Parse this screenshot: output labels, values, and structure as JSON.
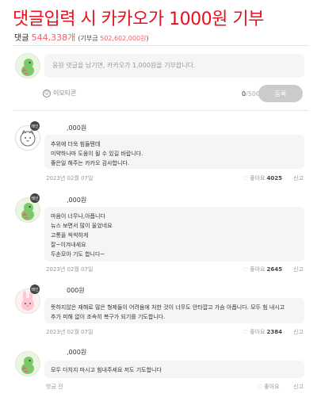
{
  "banner": "댓글입력 시 카카오가 1000원 기부",
  "summary": {
    "label": "댓글",
    "count": "544,338개",
    "donation_prefix": "(기부금 ",
    "donation_amount": "502,602,000원",
    "donation_suffix": ")"
  },
  "input": {
    "placeholder": "응원 댓글을 남기면, 카카오가 1,000원을 기부합니다.",
    "emoticon_label": "이모티콘",
    "count_current": "0",
    "count_max": "/500",
    "submit_label": "등록"
  },
  "comments": [
    {
      "name": ",000원",
      "badge": "메인",
      "lines": [
        "추위에 더욱 힘들텐데",
        "미약하나마 도움이 될 수 있길 바랍니다.",
        "좋은일 해주는 카카오 감사합니다."
      ],
      "date": "2023년 02월 07일",
      "like_label": "좋아요",
      "likes": "4025",
      "report": "신고"
    },
    {
      "name": ",000원",
      "badge": "메인",
      "lines": [
        "마음이 너무나,아픕니다",
        "뉴스 보면서 많이 울었네요",
        "고통을 씩씩하게",
        "잘~이겨내세요",
        "두손모아 기도 합니다~"
      ],
      "date": "2023년 02월 07일",
      "like_label": "좋아요",
      "likes": "2645",
      "report": "신고"
    },
    {
      "name": "000원",
      "badge": "메인",
      "lines": [
        "뜻하지않은 재해로 많은 형제들이 어려움에 처한 것이 너무도 안타깝고 가슴 아픕니다. 모두 힘 내시고",
        "추가 피해 없이 조속히 복구가 되기를 기도합니다."
      ],
      "date": "2023년 02월 07일",
      "like_label": "좋아요",
      "likes": "2384",
      "report": "신고"
    },
    {
      "name": ",000원",
      "badge": "",
      "lines": [
        "모두 다치지 마시고 힘내주세요 저도 기도합니다"
      ],
      "date": "방금 전",
      "like_label": "좋아요",
      "likes": "",
      "report": "신고"
    }
  ]
}
